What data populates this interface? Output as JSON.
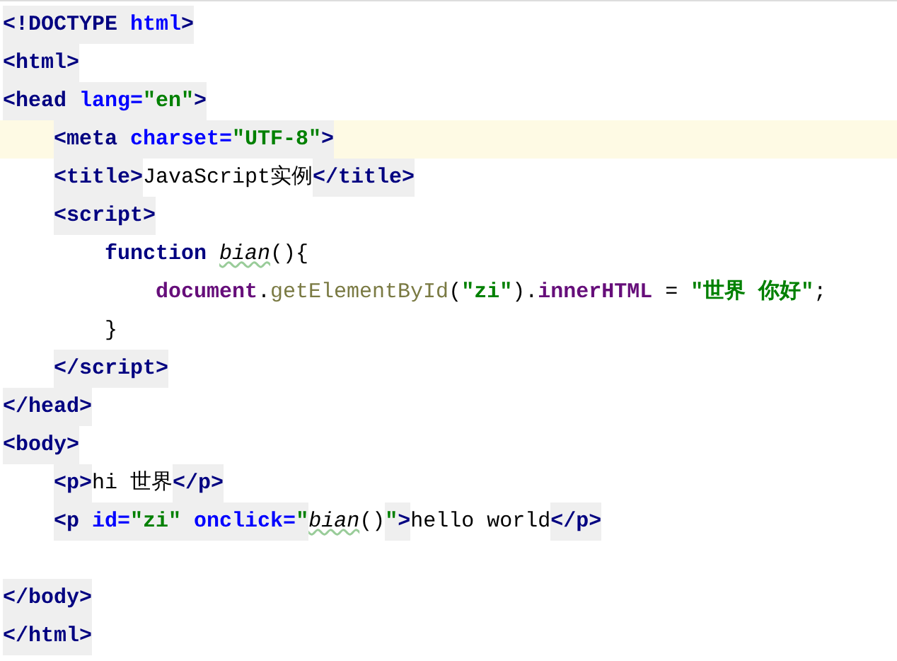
{
  "editor": {
    "lines": [
      {
        "kind": "code",
        "current": false,
        "tokens": [
          {
            "kind": "tag",
            "text": "<!DOCTYPE "
          },
          {
            "kind": "attr",
            "text": "html"
          },
          {
            "kind": "tag",
            "text": ">"
          }
        ]
      },
      {
        "kind": "code",
        "current": false,
        "tokens": [
          {
            "kind": "tag",
            "text": "<html>"
          }
        ]
      },
      {
        "kind": "code",
        "current": false,
        "tokens": [
          {
            "kind": "tag",
            "text": "<head "
          },
          {
            "kind": "attr",
            "text": "lang="
          },
          {
            "kind": "attr-value",
            "text": "\"en\""
          },
          {
            "kind": "tag",
            "text": ">"
          }
        ],
        "children": [
          {
            "kind": "code",
            "current": true,
            "tokens": [
              {
                "kind": "tag",
                "text": "<meta "
              },
              {
                "kind": "attr",
                "text": "charset="
              },
              {
                "kind": "attr-value",
                "text": "\"UTF-8\""
              },
              {
                "kind": "tag",
                "text": ">"
              }
            ]
          },
          {
            "kind": "code",
            "current": false,
            "tokens": [
              {
                "kind": "tag",
                "text": "<title>"
              },
              {
                "kind": "text",
                "text": "JavaScript实例"
              },
              {
                "kind": "tag",
                "text": "</title>"
              }
            ]
          },
          {
            "kind": "code",
            "current": false,
            "tokens": [
              {
                "kind": "tag",
                "text": "<script>"
              }
            ],
            "children": [
              {
                "kind": "code",
                "current": false,
                "tokens": [
                  {
                    "kind": "keyword",
                    "text": "function "
                  },
                  {
                    "kind": "fn-name",
                    "text": "bian"
                  },
                  {
                    "kind": "punct",
                    "text": "(){"
                  }
                ],
                "children": [
                  {
                    "kind": "code",
                    "current": false,
                    "tokens": [
                      {
                        "kind": "object",
                        "text": "document"
                      },
                      {
                        "kind": "punct",
                        "text": "."
                      },
                      {
                        "kind": "method",
                        "text": "getElementById"
                      },
                      {
                        "kind": "punct",
                        "text": "("
                      },
                      {
                        "kind": "string",
                        "text": "\"zi\""
                      },
                      {
                        "kind": "punct",
                        "text": ")."
                      },
                      {
                        "kind": "object",
                        "text": "innerHTML"
                      },
                      {
                        "kind": "punct",
                        "text": " = "
                      },
                      {
                        "kind": "string",
                        "text": "\"世界 你好\""
                      },
                      {
                        "kind": "punct",
                        "text": ";"
                      }
                    ]
                  }
                ]
              },
              {
                "kind": "code",
                "current": false,
                "tokens": [
                  {
                    "kind": "punct",
                    "text": "}"
                  }
                ]
              }
            ]
          },
          {
            "kind": "code",
            "current": false,
            "tokens": [
              {
                "kind": "tag",
                "text": "</script>"
              }
            ]
          }
        ]
      },
      {
        "kind": "code",
        "current": false,
        "tokens": [
          {
            "kind": "tag",
            "text": "</head>"
          }
        ]
      },
      {
        "kind": "code",
        "current": false,
        "tokens": [
          {
            "kind": "tag",
            "text": "<body>"
          }
        ],
        "children": [
          {
            "kind": "code",
            "current": false,
            "tokens": [
              {
                "kind": "tag",
                "text": "<p>"
              },
              {
                "kind": "text",
                "text": "hi 世界"
              },
              {
                "kind": "tag",
                "text": "</p>"
              }
            ]
          },
          {
            "kind": "code",
            "current": false,
            "tokens": [
              {
                "kind": "tag",
                "text": "<p "
              },
              {
                "kind": "attr",
                "text": "id="
              },
              {
                "kind": "attr-value",
                "text": "\"zi\" "
              },
              {
                "kind": "attr",
                "text": "onclick="
              },
              {
                "kind": "attr-value",
                "text": "\""
              },
              {
                "kind": "fn-call",
                "text": "bian"
              },
              {
                "kind": "punct",
                "text": "()"
              },
              {
                "kind": "attr-value",
                "text": "\""
              },
              {
                "kind": "tag",
                "text": ">"
              },
              {
                "kind": "text",
                "text": "hello world"
              },
              {
                "kind": "tag",
                "text": "</p>"
              }
            ]
          }
        ]
      },
      {
        "kind": "blank"
      },
      {
        "kind": "code",
        "current": false,
        "tokens": [
          {
            "kind": "tag",
            "text": "</body>"
          }
        ]
      },
      {
        "kind": "code",
        "current": false,
        "tokens": [
          {
            "kind": "tag",
            "text": "</html>"
          }
        ]
      }
    ]
  }
}
